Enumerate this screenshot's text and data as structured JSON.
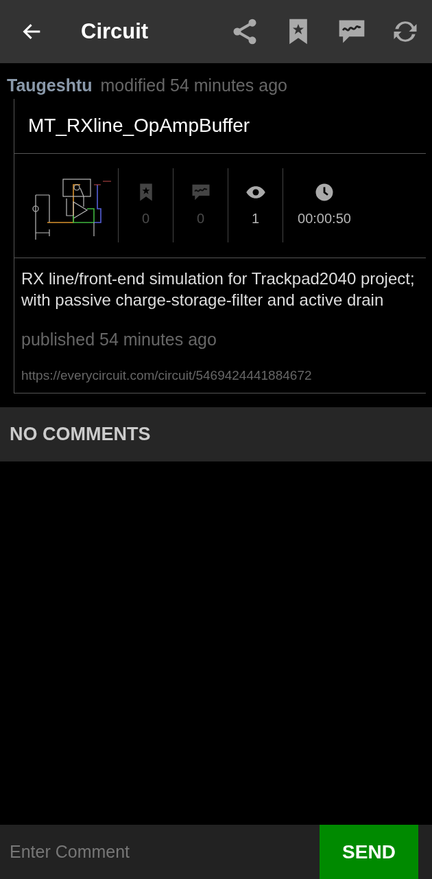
{
  "app_bar": {
    "title": "Circuit",
    "actions": [
      {
        "kind": "share"
      },
      {
        "kind": "bookmark"
      },
      {
        "kind": "comment"
      },
      {
        "kind": "refresh"
      }
    ]
  },
  "post": {
    "author": "Taugeshtu",
    "activity": "modified 54 minutes ago",
    "title": "MT_RXline_OpAmpBuffer",
    "stats": [
      {
        "kind": "bookmarks",
        "value": "0",
        "dimmed": true
      },
      {
        "kind": "comments",
        "value": "0",
        "dimmed": true
      },
      {
        "kind": "views",
        "value": "1",
        "dimmed": false
      },
      {
        "kind": "duration",
        "value": "00:00:50",
        "dimmed": false
      }
    ],
    "description": "RX line/front-end simulation for Trackpad2040 project; with passive charge-storage-filter and active drain",
    "published": "published 54 minutes ago",
    "url": "https://everycircuit.com/circuit/5469424441884672"
  },
  "comments_header": "NO COMMENTS",
  "comment_bar": {
    "placeholder": "Enter Comment",
    "send": "SEND"
  }
}
